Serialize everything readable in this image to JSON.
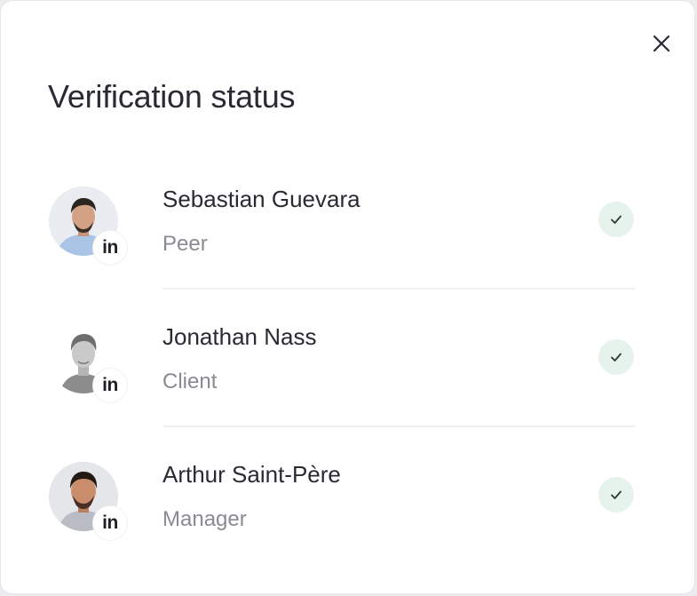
{
  "modal": {
    "title": "Verification status",
    "close_icon": "close-icon"
  },
  "verifications": [
    {
      "name": "Sebastian Guevara",
      "role": "Peer",
      "badge": "in",
      "status_icon": "check-icon",
      "status_color": "#e6f3ec"
    },
    {
      "name": "Jonathan Nass",
      "role": "Client",
      "badge": "in",
      "status_icon": "check-icon",
      "status_color": "#e6f3ec"
    },
    {
      "name": "Arthur Saint-Père",
      "role": "Manager",
      "badge": "in",
      "status_icon": "check-icon",
      "status_color": "#e6f3ec"
    }
  ]
}
